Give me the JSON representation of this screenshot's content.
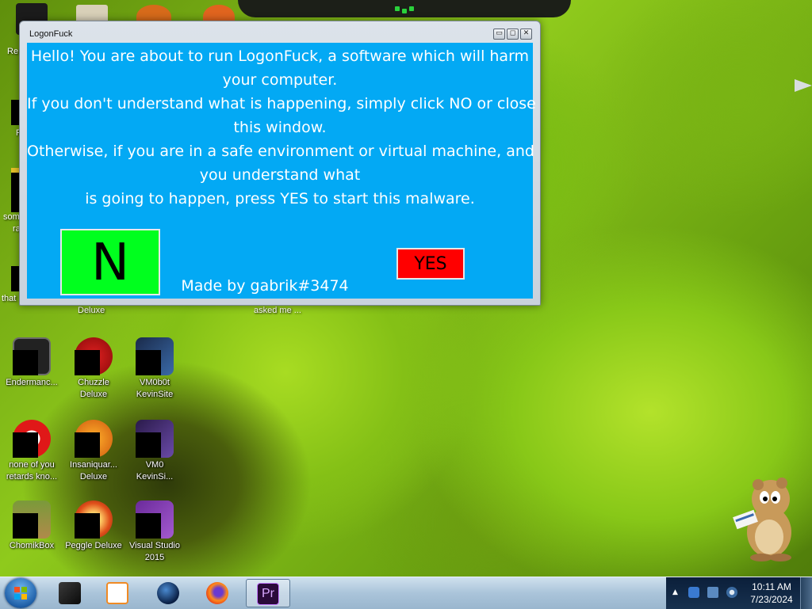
{
  "window": {
    "title": "LogonFuck",
    "controls": {
      "minimize": "▭",
      "maximize": "◻",
      "close": "✕"
    },
    "message_lines": [
      "Hello! You are about to run LogonFuck, a software which will harm",
      "your computer.",
      "If you don't understand what is happening, simply click NO or close",
      "this window.",
      "Otherwise, if you are in a safe environment or virtual machine, and",
      "you understand what",
      "is going to happen, press YES to start this malware."
    ],
    "no_button": "N",
    "yes_button": "YES",
    "credit": "Made by gabrik#3474",
    "colors": {
      "background": "#03a9f4",
      "no": "#00ff1e",
      "yes": "#ff0000"
    }
  },
  "desktop": {
    "edge_labels": [
      "Re",
      "F",
      "som",
      "ra",
      "that"
    ],
    "partial_labels": {
      "deluxe": "Deluxe",
      "asked": "asked me ..."
    },
    "icons": [
      {
        "icon": "endermanch-icon",
        "lines": [
          "Endermanc..."
        ]
      },
      {
        "icon": "chuzzle-icon",
        "lines": [
          "Chuzzle",
          "Deluxe"
        ]
      },
      {
        "icon": "vm-icon",
        "lines": [
          "VM0b0t",
          "KevinSite"
        ]
      },
      {
        "icon": "red-circle-icon",
        "lines": [
          "none of you",
          "retards kno..."
        ]
      },
      {
        "icon": "insaniquarium-icon",
        "lines": [
          "Insaniquar...",
          "Deluxe"
        ]
      },
      {
        "icon": "vm-icon",
        "lines": [
          "VM0",
          "KevinSi..."
        ]
      },
      {
        "icon": "chomikbox-icon",
        "lines": [
          "ChomikBox"
        ]
      },
      {
        "icon": "peggle-icon",
        "lines": [
          "Peggle Deluxe"
        ]
      },
      {
        "icon": "visual-studio-icon",
        "lines": [
          "Visual Studio",
          "2015"
        ]
      }
    ]
  },
  "taskbar": {
    "pinned": [
      {
        "icon": "dark-box-icon",
        "active": false
      },
      {
        "icon": "media-player-icon",
        "active": false
      },
      {
        "icon": "globe-icon",
        "active": false
      },
      {
        "icon": "firefox-icon",
        "active": false
      },
      {
        "icon": "premiere-icon",
        "label": "Pr",
        "active": true
      }
    ],
    "tray": {
      "arrow": "▲"
    },
    "clock": {
      "time": "10:11 AM",
      "date": "7/23/2024"
    }
  }
}
